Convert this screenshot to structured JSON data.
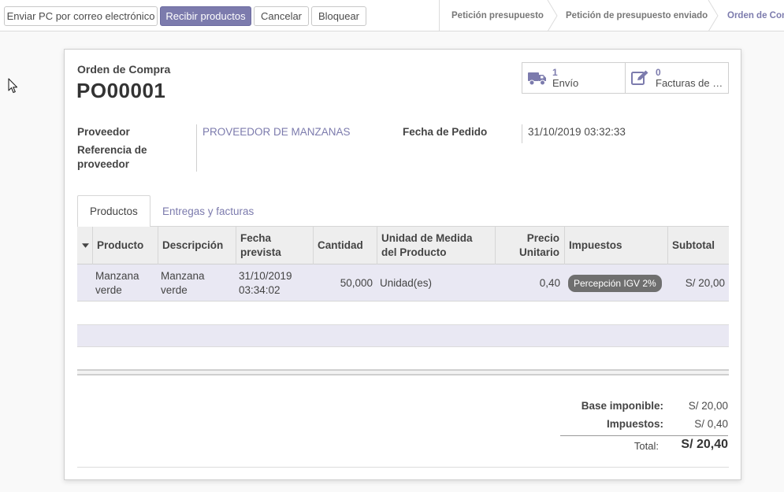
{
  "toolbar": {
    "send_po_label": "Enviar PC por correo electrónico",
    "receive_label": "Recibir productos",
    "cancel_label": "Cancelar",
    "lock_label": "Bloquear"
  },
  "statusbar": {
    "stages": [
      {
        "label": "Petición presupuesto",
        "current": false
      },
      {
        "label": "Petición de presupuesto enviado",
        "current": false
      },
      {
        "label": "Orden de Compra",
        "current": true
      }
    ]
  },
  "header": {
    "kind": "Orden de Compra",
    "name": "PO00001"
  },
  "smart_buttons": [
    {
      "count": "1",
      "label": "Envío",
      "icon": "truck-icon"
    },
    {
      "count": "0",
      "label": "Facturas de proveedor",
      "icon": "pencil-square-icon"
    }
  ],
  "fields": {
    "vendor_label": "Proveedor",
    "vendor_value": "PROVEEDOR DE MANZANAS",
    "vendor_ref_label_1": "Referencia de",
    "vendor_ref_label_2": "proveedor",
    "order_date_label": "Fecha de Pedido",
    "order_date_value": "31/10/2019 03:32:33"
  },
  "tabs": [
    {
      "label": "Productos",
      "active": true
    },
    {
      "label": "Entregas y facturas",
      "active": false
    }
  ],
  "table": {
    "columns": [
      "Producto",
      "Descripción",
      "Fecha prevista",
      "Cantidad",
      "Unidad de Medida del Producto",
      "Precio Unitario",
      "Impuestos",
      "Subtotal"
    ],
    "rows": [
      {
        "product": "Manzana verde",
        "description": "Manzana verde",
        "date_planned": "31/10/2019 03:34:02",
        "quantity": "50,000",
        "uom": "Unidad(es)",
        "price_unit": "0,40",
        "tax": "Percepción IGV 2%",
        "subtotal": "S/ 20,00"
      }
    ]
  },
  "totals": {
    "untaxed_label": "Base imponible:",
    "untaxed_value": "S/ 20,00",
    "taxes_label": "Impuestos:",
    "taxes_value": "S/ 0,40",
    "total_label": "Total:",
    "total_value": "S/ 20,40"
  },
  "colors": {
    "primary": "#7c7bad",
    "selected_row": "#e9e8f3"
  }
}
